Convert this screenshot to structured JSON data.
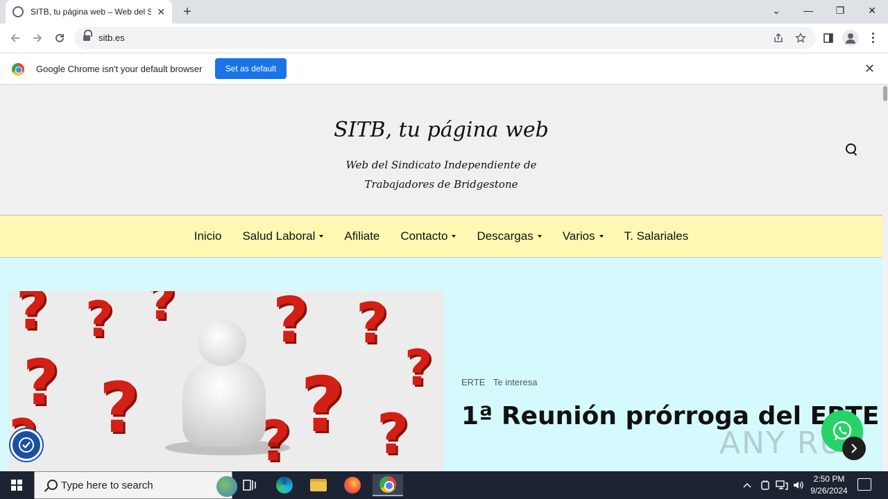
{
  "browser": {
    "tab_title": "SITB, tu página web – Web del Si",
    "tab_close": "✕",
    "new_tab": "+",
    "url": "sitb.es",
    "window_controls": {
      "dropdown": "⌄",
      "minimize": "—",
      "restore": "❐",
      "close": "✕"
    }
  },
  "infobar": {
    "message": "Google Chrome isn't your default browser",
    "button": "Set as default",
    "close": "✕"
  },
  "site": {
    "title": "SITB, tu página web",
    "description": "Web del Sindicato Independiente de Trabajadores de Bridgestone"
  },
  "nav": [
    {
      "label": "Inicio",
      "has_dropdown": false
    },
    {
      "label": "Salud Laboral",
      "has_dropdown": true
    },
    {
      "label": "Afiliate",
      "has_dropdown": false
    },
    {
      "label": "Contacto",
      "has_dropdown": true
    },
    {
      "label": "Descargas",
      "has_dropdown": true
    },
    {
      "label": "Varios",
      "has_dropdown": true
    },
    {
      "label": "T. Salariales",
      "has_dropdown": false
    }
  ],
  "post": {
    "categories": [
      "ERTE",
      "Te interesa"
    ],
    "title": "1ª Reunión prórroga del ERTE"
  },
  "watermark": "ANY RUN",
  "taskbar": {
    "search_placeholder": "Type here to search",
    "time": "2:50 PM",
    "date": "9/26/2024"
  },
  "colors": {
    "header_bg": "#f0f0f0",
    "nav_bg": "#fff8b3",
    "content_bg": "#d4fafd",
    "chrome_blue": "#1a73e8",
    "whatsapp_green": "#25d366"
  }
}
